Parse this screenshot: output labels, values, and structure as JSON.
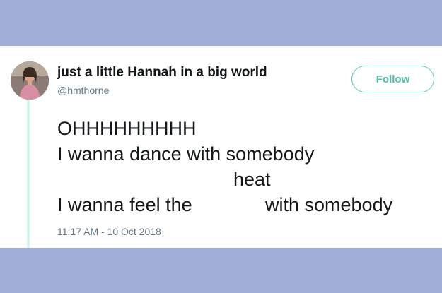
{
  "author": {
    "display_name": "just a little Hannah in a big world",
    "handle": "@hmthorne"
  },
  "follow_button": {
    "label": "Follow"
  },
  "tweet": {
    "lines": [
      "OHHHHHHHHH",
      "I wanna dance with somebody",
      "heat",
      "I wanna feel the",
      "with somebody"
    ],
    "timestamp": "11:17 AM - 10 Oct 2018"
  },
  "colors": {
    "page_background": "#a1aed9",
    "card": "#ffffff",
    "accent": "#4fc0a4",
    "thread_line": "#d4f4ee",
    "text": "#14171a",
    "muted": "#657786"
  }
}
